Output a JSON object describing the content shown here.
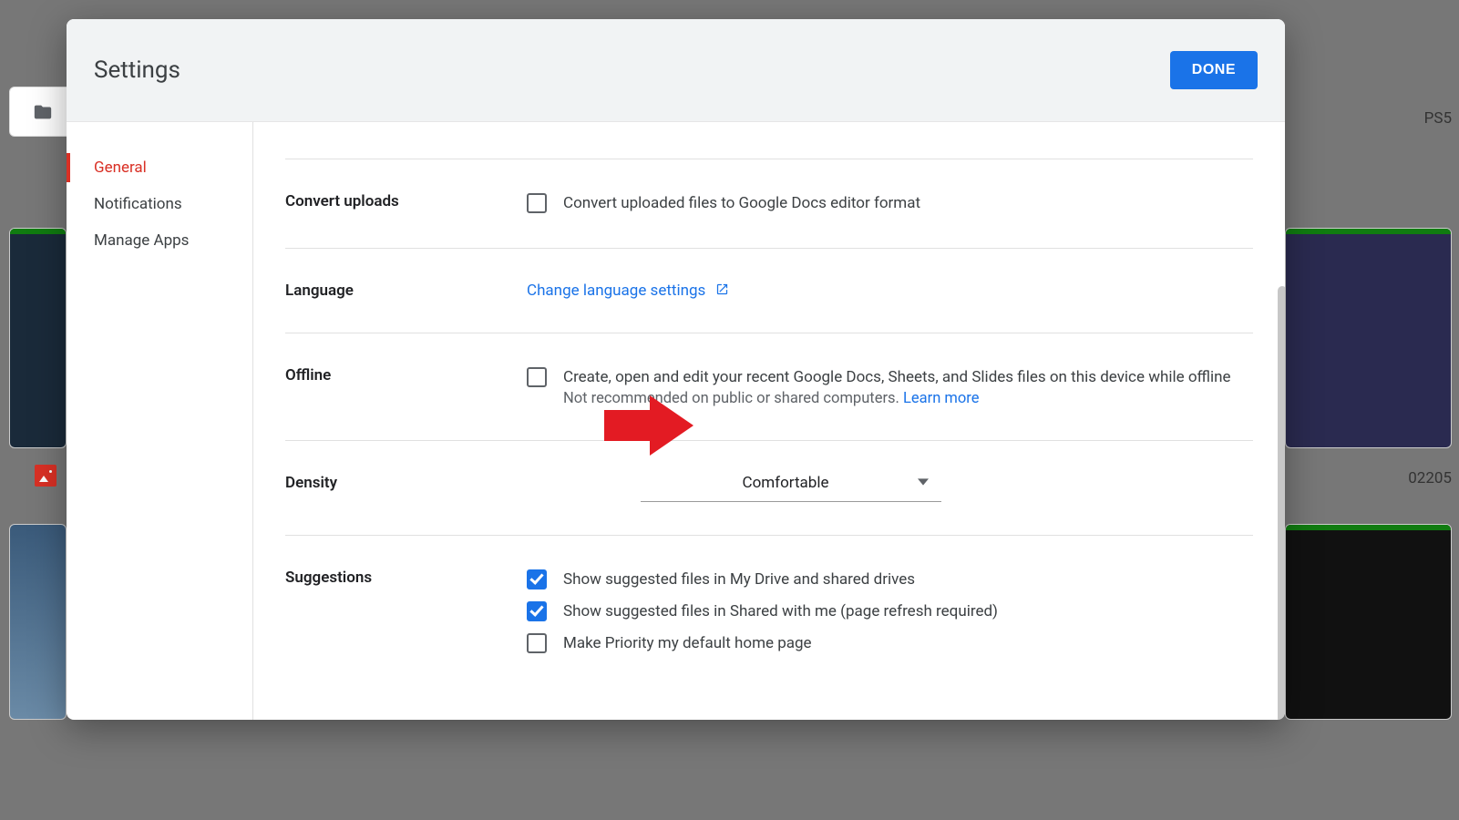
{
  "dialog": {
    "title": "Settings",
    "done": "DONE"
  },
  "sidebar": {
    "items": [
      {
        "label": "General",
        "active": true
      },
      {
        "label": "Notifications",
        "active": false
      },
      {
        "label": "Manage Apps",
        "active": false
      }
    ]
  },
  "sections": {
    "convert": {
      "label": "Convert uploads",
      "checkbox_label": "Convert uploaded files to Google Docs editor format"
    },
    "language": {
      "label": "Language",
      "link": "Change language settings"
    },
    "offline": {
      "label": "Offline",
      "checkbox_label": "Create, open and edit your recent Google Docs, Sheets, and Slides files on this device while offline",
      "note_prefix": "Not recommended on public or shared computers. ",
      "learn_more": "Learn more"
    },
    "density": {
      "label": "Density",
      "value": "Comfortable"
    },
    "suggestions": {
      "label": "Suggestions",
      "opt1": "Show suggested files in My Drive and shared drives",
      "opt2": "Show suggested files in Shared with me (page refresh required)",
      "opt3": "Make Priority my default home page"
    }
  },
  "bg_tail": "PS5",
  "bg_num": "‎02205"
}
